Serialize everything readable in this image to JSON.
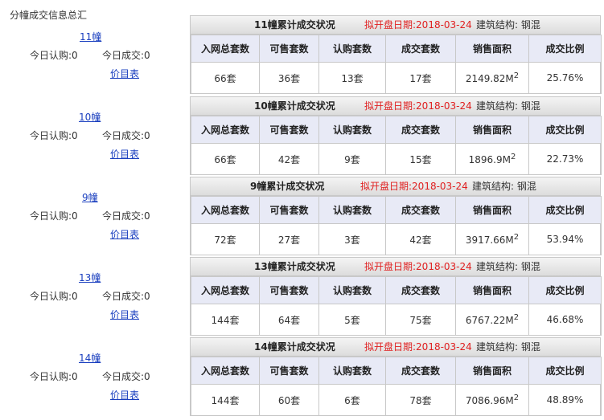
{
  "page_title": "分幢成交信息总汇",
  "labels": {
    "today_subscribe": "今日认购:",
    "today_deal": "今日成交:",
    "price_list": "价目表",
    "date_prefix": "拟开盘日期:",
    "structure_prefix": "建筑结构:"
  },
  "columns": [
    "入网总套数",
    "可售套数",
    "认购套数",
    "成交套数",
    "销售面积",
    "成交比例"
  ],
  "buildings": [
    {
      "link": "11幢",
      "today_subscribe": "0",
      "today_deal": "0",
      "panel_title": "11幢累计成交状况",
      "open_date": "2018-03-24",
      "structure": "钢混",
      "total": "66套",
      "available": "36套",
      "subscribed": "13套",
      "sold": "17套",
      "area": "2149.82M",
      "ratio": "25.76%"
    },
    {
      "link": "10幢",
      "today_subscribe": "0",
      "today_deal": "0",
      "panel_title": "10幢累计成交状况",
      "open_date": "2018-03-24",
      "structure": "钢混",
      "total": "66套",
      "available": "42套",
      "subscribed": "9套",
      "sold": "15套",
      "area": "1896.9M",
      "ratio": "22.73%"
    },
    {
      "link": "9幢",
      "today_subscribe": "0",
      "today_deal": "0",
      "panel_title": "9幢累计成交状况",
      "open_date": "2018-03-24",
      "structure": "钢混",
      "total": "72套",
      "available": "27套",
      "subscribed": "3套",
      "sold": "42套",
      "area": "3917.66M",
      "ratio": "53.94%"
    },
    {
      "link": "13幢",
      "today_subscribe": "0",
      "today_deal": "0",
      "panel_title": "13幢累计成交状况",
      "open_date": "2018-03-24",
      "structure": "钢混",
      "total": "144套",
      "available": "64套",
      "subscribed": "5套",
      "sold": "75套",
      "area": "6767.22M",
      "ratio": "46.68%"
    },
    {
      "link": "14幢",
      "today_subscribe": "0",
      "today_deal": "0",
      "panel_title": "14幢累计成交状况",
      "open_date": "2018-03-24",
      "structure": "钢混",
      "total": "144套",
      "available": "60套",
      "subscribed": "6套",
      "sold": "78套",
      "area": "7086.96M",
      "ratio": "48.89%"
    }
  ],
  "area_unit_sup": "2",
  "colors": {
    "link": "#1a3fbf",
    "date": "#e02020",
    "header_bg": "#e8eaf6"
  }
}
